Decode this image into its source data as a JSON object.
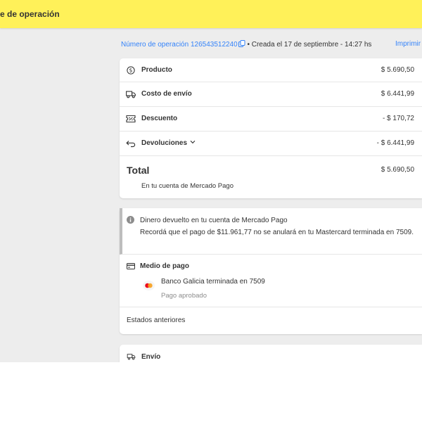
{
  "header": {
    "title": "e de operación"
  },
  "operation": {
    "number_label": "Número de operación 126543512240",
    "created": "• Creada el 17 de septiembre - 14:27 hs",
    "print_label": "Imprimir"
  },
  "summary": {
    "rows": [
      {
        "label": "Producto",
        "amount": "$ 5.690,50",
        "icon": "dollar-circle-icon"
      },
      {
        "label": "Costo de envío",
        "amount": "$ 6.441,99",
        "icon": "truck-icon"
      },
      {
        "label": "Descuento",
        "amount": "- $ 170,72",
        "icon": "coupon-icon"
      },
      {
        "label": "Devoluciones",
        "amount": "- $ 6.441,99",
        "icon": "return-arrow-icon"
      }
    ],
    "total_label": "Total",
    "total_amount": "$ 5.690,50",
    "total_sub": "En tu cuenta de Mercado Pago"
  },
  "refund_notice": {
    "title": "Dinero devuelto en tu cuenta de Mercado Pago",
    "description": "Recordá que el pago de $11.961,77 no se anulará en tu Mastercard terminada en 7509."
  },
  "payment_method": {
    "title": "Medio de pago",
    "bank": "Banco Galicia terminada en 7509",
    "status": "Pago aprobado",
    "brand_colors": {
      "red": "#eb001b",
      "yellow": "#f79e1b"
    }
  },
  "previous_states": "Estados anteriores",
  "shipping": {
    "label": "Envío"
  },
  "colors": {
    "accent_yellow": "#fff159",
    "link_blue": "#3483fa",
    "background": "#ededed"
  }
}
